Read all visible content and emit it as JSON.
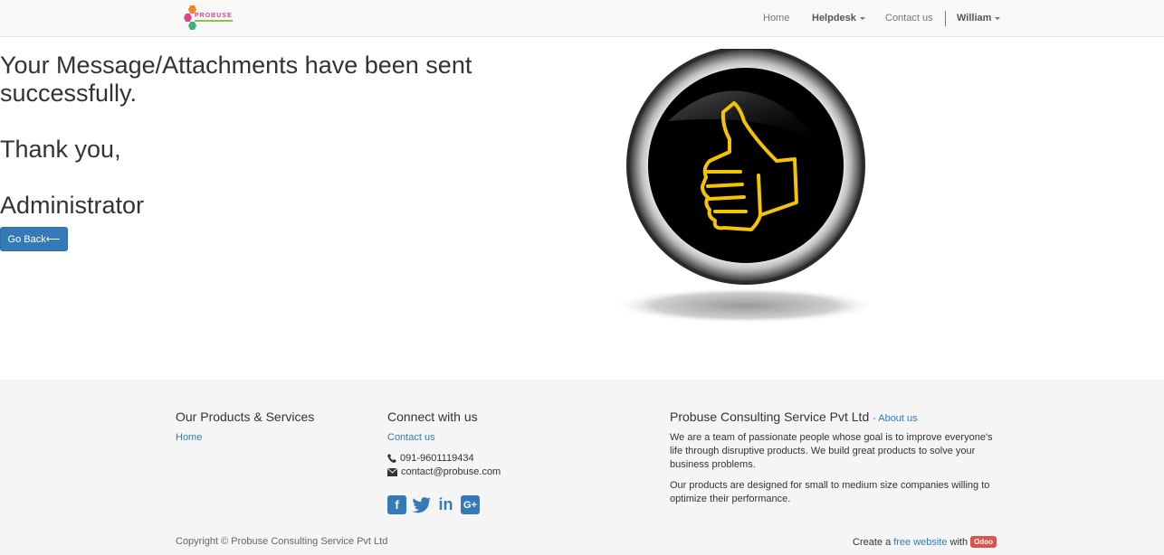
{
  "navbar": {
    "logo_text": "PROBUSE",
    "items": [
      {
        "label": "Home"
      },
      {
        "label": "Helpdesk"
      },
      {
        "label": "Contact us"
      },
      {
        "label": "William"
      }
    ]
  },
  "main": {
    "line1": "Your Message/Attachments have been sent",
    "line2": "successfully.",
    "thanks": "Thank you,",
    "signature": "Administrator",
    "back_button": "Go Back⟵"
  },
  "footer": {
    "products_heading": "Our Products & Services",
    "products_link": "Home",
    "connect_heading": "Connect with us",
    "connect_link": "Contact us",
    "phone": "091-9601119434",
    "email": "contact@probuse.com",
    "company_heading": "Probuse Consulting Service Pvt Ltd",
    "about_link": "- About us",
    "about_p1": "We are a team of passionate people whose goal is to improve everyone's life through disruptive products. We build great products to solve your business problems.",
    "about_p2": "Our products are designed for small to medium size companies willing to optimize their performance.",
    "copyright": "Copyright © Probuse Consulting Service Pvt Ltd",
    "create_prefix": "Create a",
    "create_link": "free website",
    "create_with": "with",
    "odoo": "Odoo"
  },
  "icons": {
    "social": [
      "facebook-icon",
      "twitter-icon",
      "linkedin-icon",
      "google-plus-icon"
    ],
    "phone": "phone-icon",
    "email": "envelope-icon"
  },
  "colors": {
    "link": "#337ab7",
    "button": "#337ab7",
    "thumb": "#f5c400",
    "odoo_badge": "#d9534f"
  }
}
